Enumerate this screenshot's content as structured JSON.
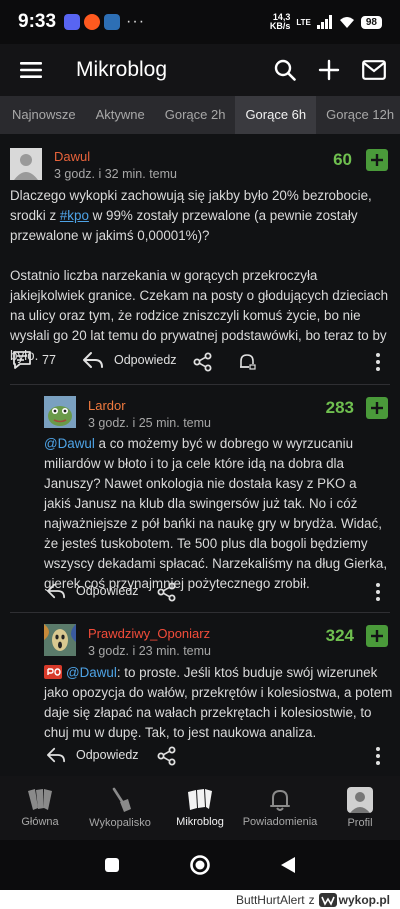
{
  "status_bar": {
    "time": "9:33",
    "more": "···",
    "speed_top": "14,3",
    "speed_bottom": "KB/s",
    "network": "LTE",
    "battery": "98"
  },
  "app_bar": {
    "title": "Mikroblog"
  },
  "tabs": [
    {
      "label": "Najnowsze"
    },
    {
      "label": "Aktywne"
    },
    {
      "label": "Gorące 2h"
    },
    {
      "label": "Gorące 6h",
      "active": true
    },
    {
      "label": "Gorące 12h"
    }
  ],
  "post": {
    "author": "Dawul",
    "time": "3 godz. i 32 min. temu",
    "score": "60",
    "line1": "Dlaczego wykopki zachowują się jakby było 20% bezrobocie,",
    "line2_pre": "srodki z ",
    "line2_tag": "#kpo",
    "line2_post": " w 99% zostały przewalone (a pewnie zostały",
    "line3": "przewalone w jakimś 0,00001%)?",
    "paragraph2": [
      "Ostatnio liczba narzekania w gorących przekroczyła",
      "jakiejkolwiek granice. Czekam na posty o głodujących dzieciach",
      "na ulicy oraz tym, że rodzice zniszczyli komuś życie, bo nie",
      "wysłali go 20 lat temu do prywatnej podstawówki, bo teraz to by",
      "było."
    ],
    "comments_count": "77",
    "reply_label": "Odpowiedz"
  },
  "comments": [
    {
      "author": "Lardor",
      "time": "3 godz. i 25 min. temu",
      "score": "283",
      "mention": "@Dawul",
      "first_line_rest": " a co możemy być w dobrego w wyrzucaniu",
      "lines": [
        "miliardów w błoto i to ja cele które idą na dobra dla",
        "Januszy? Nawet onkologia nie dostała kasy z PKO a",
        "jakiś Janusz na klub dla swingersów już tak. No i cóż",
        "najważniejsze z pół bańki na naukę gry w brydża. Widać,",
        "że jesteś tuskobotem. Te 500 plus dla bogoli będziemy",
        "wszyscy dekadami spłacać. Narzekaliśmy na dług Gierka,",
        "gierek coś przynajmniej pożytecznego zrobił."
      ],
      "reply_label": "Odpowiedz"
    },
    {
      "author": "Prawdziwy_Oponiarz",
      "time": "3 godz. i 23 min. temu",
      "score": "324",
      "mention": "@Dawul",
      "first_line_rest": ": to proste. Jeśli ktoś buduje swój wizerunek",
      "lines": [
        "jako opozycja do wałów, przekrętów i kolesiostwa, a potem",
        "daje się złapać na wałach przekrętach i kolesiostwie, to",
        "chuj mu w dupę. Tak, to jest naukowa analiza."
      ],
      "reply_label": "Odpowiedz"
    }
  ],
  "bottom_nav": [
    {
      "label": "Główna",
      "icon": "home-w-icon"
    },
    {
      "label": "Wykopalisko",
      "icon": "shovel-icon"
    },
    {
      "label": "Mikroblog",
      "icon": "mikroblog-icon",
      "active": true
    },
    {
      "label": "Powiadomienia",
      "icon": "bell-icon"
    },
    {
      "label": "Profil",
      "icon": "profile-icon"
    }
  ],
  "watermark": {
    "user": "ButtHurtAlert",
    "z": "z",
    "site": "wykop.pl"
  },
  "colors": {
    "accent_green": "#4a9a3a",
    "score_green": "#6fbf4f",
    "link_blue": "#4ea3e6",
    "author_orange": "#e8633b"
  }
}
